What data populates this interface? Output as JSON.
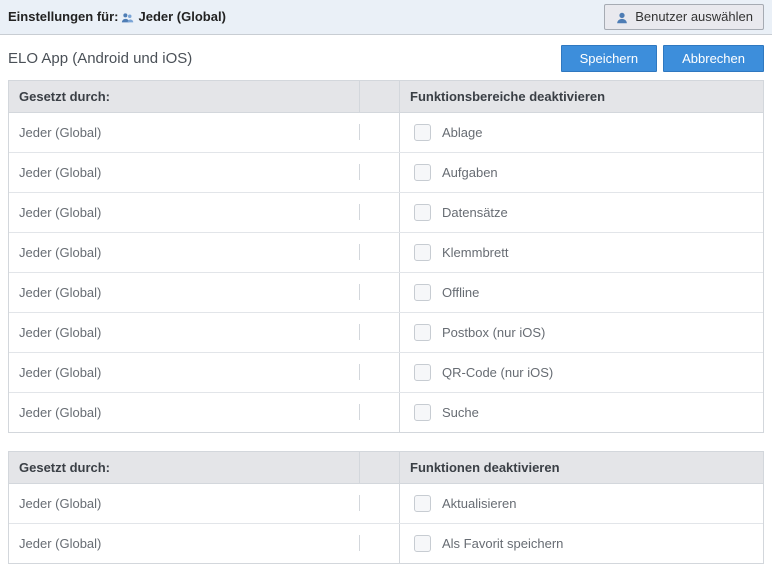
{
  "topbar": {
    "settings_for_label": "Einstellungen für:",
    "current_user": "Jeder (Global)",
    "select_user_button": "Benutzer auswählen"
  },
  "section": {
    "title": "ELO App (Android und iOS)",
    "save_label": "Speichern",
    "cancel_label": "Abbrechen"
  },
  "table1": {
    "header_setby": "Gesetzt durch:",
    "header_function": "Funktionsbereiche deaktivieren",
    "rows": [
      {
        "setby": "Jeder (Global)",
        "label": "Ablage"
      },
      {
        "setby": "Jeder (Global)",
        "label": "Aufgaben"
      },
      {
        "setby": "Jeder (Global)",
        "label": "Datensätze"
      },
      {
        "setby": "Jeder (Global)",
        "label": "Klemmbrett"
      },
      {
        "setby": "Jeder (Global)",
        "label": "Offline"
      },
      {
        "setby": "Jeder (Global)",
        "label": "Postbox (nur iOS)"
      },
      {
        "setby": "Jeder (Global)",
        "label": "QR-Code (nur iOS)"
      },
      {
        "setby": "Jeder (Global)",
        "label": "Suche"
      }
    ]
  },
  "table2": {
    "header_setby": "Gesetzt durch:",
    "header_function": "Funktionen deaktivieren",
    "rows": [
      {
        "setby": "Jeder (Global)",
        "label": "Aktualisieren"
      },
      {
        "setby": "Jeder (Global)",
        "label": "Als Favorit speichern"
      }
    ]
  }
}
